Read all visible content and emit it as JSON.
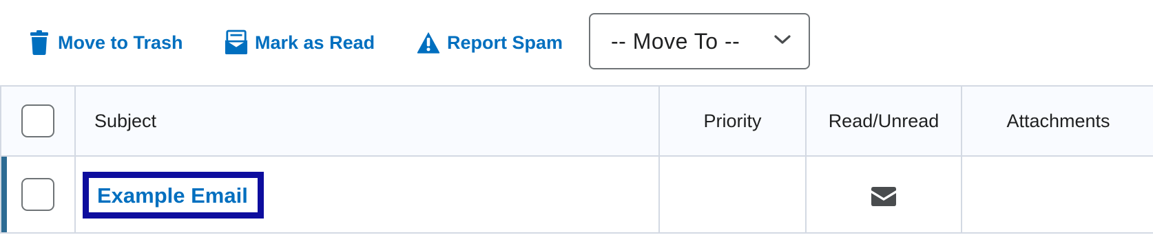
{
  "toolbar": {
    "trash_label": "Move to Trash",
    "mark_read_label": "Mark as Read",
    "spam_label": "Report Spam",
    "move_to": {
      "selected": "-- Move To --"
    }
  },
  "table": {
    "headers": {
      "subject": "Subject",
      "priority": "Priority",
      "read_unread": "Read/Unread",
      "attachments": "Attachments"
    },
    "rows": [
      {
        "subject": "Example Email",
        "priority": "",
        "read_state_icon": "envelope-icon",
        "attachments": ""
      }
    ]
  },
  "colors": {
    "accent": "#006fbf",
    "focus_outline": "#0d0d9e",
    "row_marker": "#2d6b93",
    "border": "#d3d9e3",
    "header_bg": "#f9fbff"
  }
}
